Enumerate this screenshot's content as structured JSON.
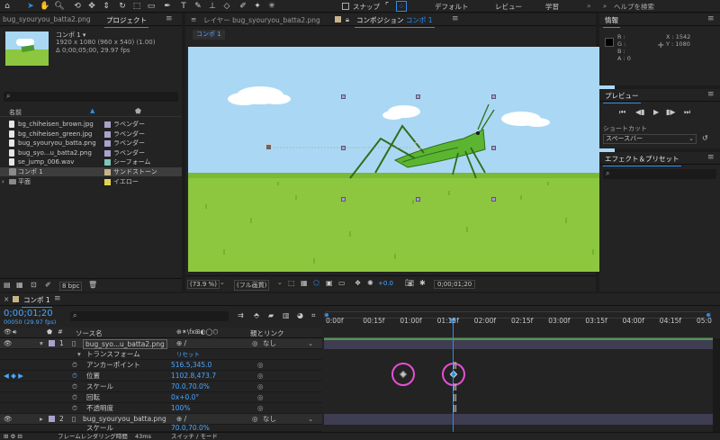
{
  "toolbar": {
    "snap_label": "スナップ",
    "workspaces": [
      "デフォルト",
      "レビュー",
      "学習"
    ],
    "help_placeholder": "ヘルプを検索"
  },
  "project_panel": {
    "tab_file": "bug_syouryou_batta2.png",
    "tab_project": "プロジェクト",
    "comp_name": "コンポ 1 ▾",
    "comp_info_1": "1920 x 1080 (960 x 540) (1.00)",
    "comp_info_2": "Δ 0;00;05;00, 29.97 fps",
    "col_name": "名前",
    "items": [
      {
        "name": "bg_chiheisen_brown.jpg",
        "label": "ラベンダー",
        "color": "#a9a3cc",
        "type": "file"
      },
      {
        "name": "bg_chiheisen_green.jpg",
        "label": "ラベンダー",
        "color": "#a9a3cc",
        "type": "file"
      },
      {
        "name": "bug_syouryou_batta.png",
        "label": "ラベンダー",
        "color": "#a9a3cc",
        "type": "file"
      },
      {
        "name": "bug_syo...u_batta2.png",
        "label": "ラベンダー",
        "color": "#a9a3cc",
        "type": "file"
      },
      {
        "name": "se_jump_006.wav",
        "label": "シーフォーム",
        "color": "#7ec7b8",
        "type": "file"
      },
      {
        "name": "コンポ 1",
        "label": "サンドストーン",
        "color": "#c9b48a",
        "type": "comp"
      },
      {
        "name": "平面",
        "label": "イエロー",
        "color": "#e3d34e",
        "type": "folder"
      }
    ],
    "bpc": "8 bpc"
  },
  "viewer": {
    "tab_layer": "レイヤー bug_syouryou_batta2.png",
    "tab_comp": "コンポジション",
    "tab_comp_name": "コンポ 1",
    "comp_chip": "コンポ 1",
    "zoom": "(73.9 %)",
    "quality": "(フル画質)",
    "exposure": "+0.0",
    "timecode": "0;00;01;20"
  },
  "info_panel": {
    "title": "情報",
    "r": "R :",
    "g": "G :",
    "b": "B :",
    "a": "A :  0",
    "x": "X : 1542",
    "y": "Y : 1080"
  },
  "preview_panel": {
    "title": "プレビュー",
    "shortcut_label": "ショートカット",
    "shortcut_value": "スペースバー"
  },
  "effects_panel": {
    "title": "エフェクト＆プリセット"
  },
  "timeline": {
    "tab": "コンポ 1",
    "timecode": "0;00;01;20",
    "fps_sub": "00050 (29.97 fps)",
    "col_source": "ソース名",
    "col_parent": "親とリンク",
    "ruler": [
      "0:00f",
      "00:15f",
      "01:00f",
      "01:15f",
      "02:00f",
      "02:15f",
      "03:00f",
      "03:15f",
      "04:00f",
      "04:15f",
      "05:0"
    ],
    "layers": [
      {
        "num": "1",
        "name": "bug_syo...u_batta2.png",
        "parent": "なし"
      },
      {
        "num": "2",
        "name": "bug_syouryou_batta.png",
        "parent": "なし"
      }
    ],
    "transform": "トランスフォーム",
    "reset": "リセット",
    "props": [
      {
        "name": "アンカーポイント",
        "value": "516.5,345.0"
      },
      {
        "name": "位置",
        "value": "1102.8,473.7"
      },
      {
        "name": "スケール",
        "value": "70.0,70.0%"
      },
      {
        "name": "回転",
        "value": "0x+0.0°"
      },
      {
        "name": "不透明度",
        "value": "100%"
      }
    ],
    "layer2_scale": "70.0,70.0%",
    "layer2_scale_label": "スケール",
    "footer_render": "フレームレンダリング時間",
    "footer_ms": "43ms",
    "footer_switch": "スイッチ / モード"
  }
}
